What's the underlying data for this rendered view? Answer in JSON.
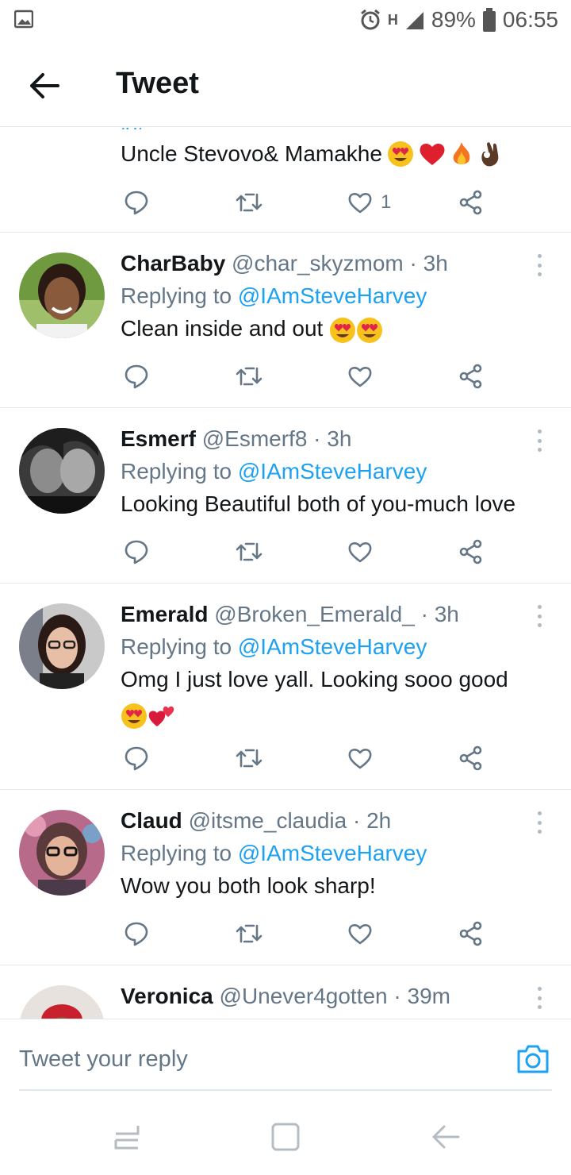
{
  "status_bar": {
    "battery_percent": "89%",
    "time": "06:55",
    "network_type": "H",
    "icons": [
      "gallery-icon",
      "alarm-icon",
      "signal-icon",
      "battery-icon"
    ]
  },
  "header": {
    "title": "Tweet",
    "back_icon": "arrow-left-icon"
  },
  "partial_tweet": {
    "text": "Uncle Stevovo& Mamakhe",
    "emojis": [
      "heart-eyes",
      "red-heart",
      "fire",
      "ok-hand"
    ],
    "like_count": "1"
  },
  "tweets": [
    {
      "name": "CharBaby",
      "handle": "@char_skyzmom",
      "time": "· 3h",
      "replying_prefix": "Replying to",
      "replying_to": "@IAmSteveHarvey",
      "text": "Clean inside and out",
      "emojis": [
        "heart-eyes",
        "heart-eyes"
      ]
    },
    {
      "name": "Esmerf",
      "handle": "@Esmerf8",
      "time": "· 3h",
      "replying_prefix": "Replying to",
      "replying_to": "@IAmSteveHarvey",
      "text": "Looking Beautiful both of you-much love",
      "emojis": []
    },
    {
      "name": "Emerald",
      "handle": "@Broken_Emerald_",
      "time": "· 3h",
      "replying_prefix": "Replying to",
      "replying_to": "@IAmSteveHarvey",
      "text": "Omg I just love yall. Looking sooo good",
      "emojis": [
        "heart-eyes",
        "two-hearts"
      ]
    },
    {
      "name": "Claud",
      "handle": "@itsme_claudia",
      "time": "· 2h",
      "replying_prefix": "Replying to",
      "replying_to": "@IAmSteveHarvey",
      "text": "Wow you both look sharp!",
      "emojis": []
    },
    {
      "name": "Veronica",
      "handle": "@Unever4gotten",
      "time": "· 39m",
      "replying_prefix": "",
      "replying_to": "",
      "text": "",
      "emojis": []
    }
  ],
  "action_icons": [
    "reply-icon",
    "retweet-icon",
    "like-icon",
    "share-icon"
  ],
  "reply_bar": {
    "placeholder": "Tweet your reply",
    "camera_icon": "camera-icon"
  },
  "nav_bar": {
    "icons": [
      "recent-apps-icon",
      "home-icon",
      "back-icon"
    ]
  },
  "colors": {
    "accent": "#1da1f2",
    "text_primary": "#14171a",
    "text_secondary": "#657786",
    "divider": "#e1e8ed"
  }
}
